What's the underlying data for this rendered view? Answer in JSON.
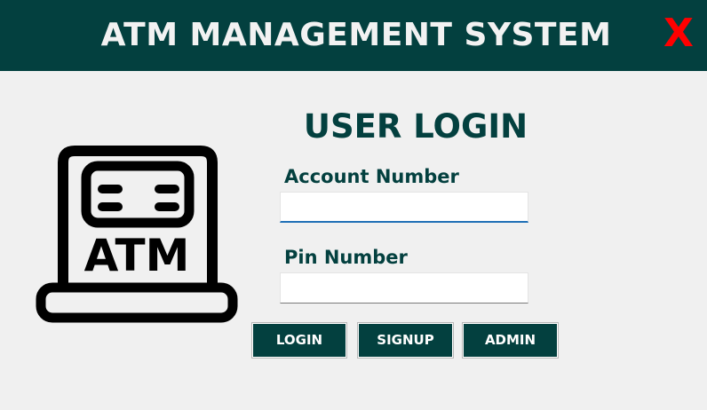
{
  "header": {
    "title": "ATM MANAGEMENT SYSTEM",
    "close_label": "X",
    "background": "#03403f",
    "close_color": "#ff0000"
  },
  "icon": {
    "name": "atm-machine-icon",
    "label": "ATM"
  },
  "form": {
    "title": "USER LOGIN",
    "account_label": "Account Number",
    "account_value": "",
    "pin_label": "Pin Number",
    "pin_value": ""
  },
  "buttons": {
    "login": "LOGIN",
    "signup": "SIGNUP",
    "admin": "ADMIN"
  },
  "colors": {
    "accent": "#03403f",
    "background": "#f0f0f0",
    "focus_underline": "#1f6fb6"
  }
}
